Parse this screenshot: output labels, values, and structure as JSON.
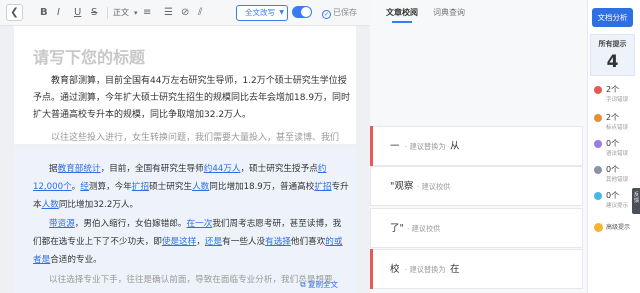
{
  "toolbar": {
    "back_icon": "chevron-left-icon",
    "bold": "B",
    "italic": "I",
    "underline": "U",
    "strike": "S",
    "text_style": "正文",
    "mode_label": "全文改写",
    "saved_label": "已保存"
  },
  "editor": {
    "title_placeholder": "请写下您的标题",
    "paragraph1": "教育部测算，目前全国有44万左右研究生导师，1.2万个硕士研究生学位授予点。通过测算，今年扩大硕士研究生招生的规模同比去年会增加18.9万，同时扩大普通高校专升本的规模，同比争取增加32.2万人。",
    "paragraph2": "以往这些投入进行，女生转换问题，我们需要大量投入，甚至读博、我们"
  },
  "review": {
    "p1_a": "据",
    "p1_u1": "教育部统计",
    "p1_b": "，目前，全国有研究生导师",
    "p1_u2": "约44万人",
    "p1_c": "，硕士研究生授予点",
    "p1_u3": "约12,000个",
    "p1_d": "。",
    "p1_u4": "经",
    "p1_e": "测算，今年",
    "p1_u5": "扩招",
    "p1_f": "硕士研究生",
    "p1_u6": "人数",
    "p1_g": "同比增加18.9万，普通高校",
    "p1_u7": "扩招",
    "p1_h": "专升本",
    "p1_u8": "人数",
    "p1_i": "同比增加32.2万人。",
    "p2_u1": "带资源",
    "p2_a": "，男伯入缩行，女伯嫁错郎。",
    "p2_u2": "在一次",
    "p2_b": "我们周考志愿考研，甚至读博，我们都在选专业上下了不少功夫，即",
    "p2_u3": "使是这样",
    "p2_c": "，",
    "p2_u4": "还是",
    "p2_d": "有一些人没",
    "p2_u5": "有选择",
    "p2_e": "他们喜欢",
    "p2_u6": "的或者是",
    "p2_f": "合适的专业。",
    "p3": "以往选择专业下手，往往是确认前面，导致在面临专业分析，我们总是想要",
    "copy_label": "复制全文"
  },
  "review_panel": {
    "tabs": [
      "文章校阅",
      "词典查询"
    ],
    "cards": [
      {
        "word": "一",
        "hint": "· 建议替换为",
        "replacement": "从",
        "flag": true
      },
      {
        "word": "\"观察",
        "hint": "· 建议校供",
        "replacement": "",
        "flag": false
      },
      {
        "word": "了\"",
        "hint": "· 建议校供",
        "replacement": "",
        "flag": false
      },
      {
        "word": "校",
        "hint": "· 建议替换为",
        "replacement": "在",
        "flag": true
      }
    ]
  },
  "sidebar": {
    "analyze_label": "文档分析",
    "all_label": "所有提示",
    "all_count": "4",
    "categories": [
      {
        "count": "2个",
        "name": "字词错误",
        "color": "#e55a54"
      },
      {
        "count": "2个",
        "name": "标点错误",
        "color": "#e58e3a"
      },
      {
        "count": "0个",
        "name": "语法错误",
        "color": "#9a7be8"
      },
      {
        "count": "0个",
        "name": "其他错误",
        "color": "#8a94a6"
      },
      {
        "count": "0个",
        "name": "建议提示",
        "color": "#45b8e8"
      }
    ],
    "highlight_label": "高级提示",
    "side_tab": "反馈"
  }
}
